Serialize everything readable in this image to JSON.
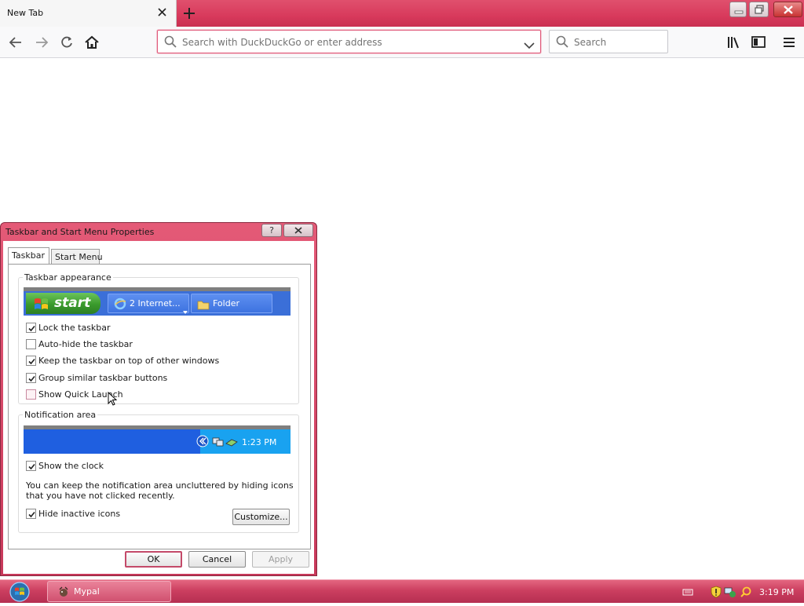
{
  "browser": {
    "tab_title": "New Tab",
    "url_placeholder": "Search with DuckDuckGo or enter address",
    "search_placeholder": "Search"
  },
  "dialog": {
    "title": "Taskbar and Start Menu Properties",
    "help_label": "?",
    "tabs": [
      {
        "label": "Taskbar",
        "active": true
      },
      {
        "label": "Start Menu",
        "active": false
      }
    ],
    "appearance_group": "Taskbar appearance",
    "preview": {
      "start_label": "start",
      "task1_label": "2 Internet...",
      "task2_label": "Folder"
    },
    "options": [
      {
        "label": "Lock the taskbar",
        "checked": true
      },
      {
        "label": "Auto-hide the taskbar",
        "checked": false
      },
      {
        "label": "Keep the taskbar on top of other windows",
        "checked": true
      },
      {
        "label": "Group similar taskbar buttons",
        "checked": true
      },
      {
        "label": "Show Quick Launch",
        "checked": false
      }
    ],
    "notification_group": "Notification area",
    "notification_time": "1:23 PM",
    "show_clock": {
      "label": "Show the clock",
      "checked": true
    },
    "description": "You can keep the notification area uncluttered by hiding icons that you have not clicked recently.",
    "hide_inactive": {
      "label": "Hide inactive icons",
      "checked": true
    },
    "customize_label": "Customize...",
    "ok_label": "OK",
    "cancel_label": "Cancel",
    "apply_label": "Apply"
  },
  "taskbar": {
    "app_label": "Mypal",
    "clock": "3:19 PM"
  },
  "colors": {
    "accent": "#d83a5c",
    "xp_blue": "#3b6fd8",
    "xp_green": "#3a9a2c"
  }
}
